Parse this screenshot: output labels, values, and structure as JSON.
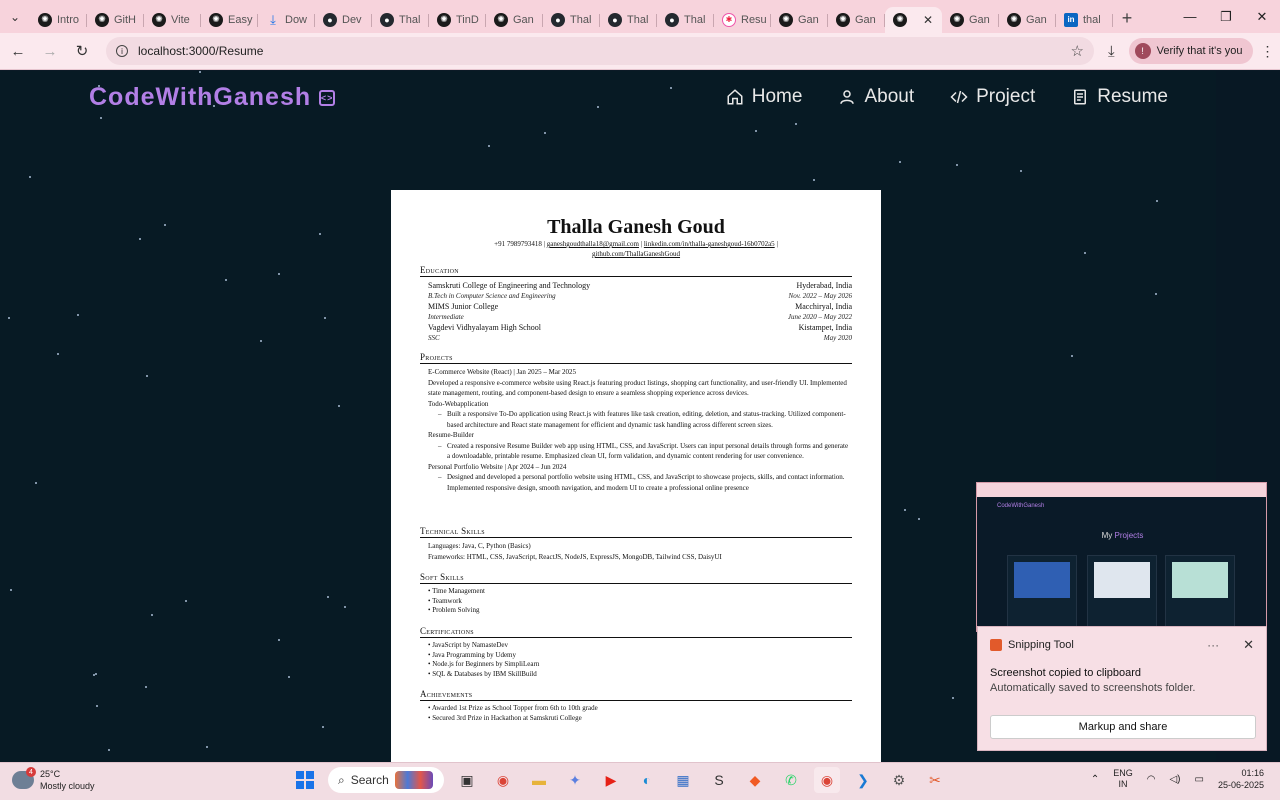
{
  "browser": {
    "tabs": [
      {
        "label": "Intro",
        "icon": "openai-icon"
      },
      {
        "label": "GitH",
        "icon": "openai-icon"
      },
      {
        "label": "Vite",
        "icon": "openai-icon"
      },
      {
        "label": "Easy",
        "icon": "openai-icon"
      },
      {
        "label": "Dow",
        "icon": "download-icon"
      },
      {
        "label": "Dev",
        "icon": "github-icon"
      },
      {
        "label": "Thal",
        "icon": "github-icon"
      },
      {
        "label": "TinD",
        "icon": "openai-icon"
      },
      {
        "label": "Gan",
        "icon": "openai-icon"
      },
      {
        "label": "Thal",
        "icon": "github-icon"
      },
      {
        "label": "Thal",
        "icon": "github-icon"
      },
      {
        "label": "Thal",
        "icon": "github-icon"
      },
      {
        "label": "Resu",
        "icon": "extension-icon"
      },
      {
        "label": "Gan",
        "icon": "openai-icon"
      },
      {
        "label": "Gan",
        "icon": "openai-icon"
      },
      {
        "label": "",
        "icon": "openai-icon",
        "active": true
      },
      {
        "label": "Gan",
        "icon": "openai-icon"
      },
      {
        "label": "Gan",
        "icon": "openai-icon"
      },
      {
        "label": "thal",
        "icon": "linkedin-icon"
      }
    ],
    "url": "localhost:3000/Resume",
    "verify_label": "Verify that it's you"
  },
  "site": {
    "brand": "CodeWithGanesh",
    "nav": [
      {
        "label": "Home",
        "icon": "home-icon"
      },
      {
        "label": "About",
        "icon": "user-icon"
      },
      {
        "label": "Project",
        "icon": "code-icon"
      },
      {
        "label": "Resume",
        "icon": "document-icon"
      }
    ],
    "brand_color": "#b27fe6"
  },
  "resume": {
    "name": "Thalla Ganesh Goud",
    "contact_line1": "+91 7989793418 | ",
    "email": "ganeshgoudthalla18@gmail.com",
    "sep": " | ",
    "linkedin": "linkedin.com/in/thalla-ganeshgoud-16b0702a5",
    "contact_tail": " |",
    "github": "github.com/ThallaGaneshGoud",
    "education_title": "Education",
    "education": [
      {
        "school": "Samskruti College of Engineering and Technology",
        "place": "Hyderabad, India",
        "degree": "B.Tech in Computer Science and Engineering",
        "dates": "Nov. 2022 – May 2026"
      },
      {
        "school": "MIMS Junior College",
        "place": "Macchiryal, India",
        "degree": "Intermediate",
        "dates": "June 2020 – May 2022"
      },
      {
        "school": "Vagdevi Vidhyalayam High School",
        "place": "Kistampet, India",
        "degree": "SSC",
        "dates": "May 2020"
      }
    ],
    "projects_title": "Projects",
    "projects": {
      "p1_title": "E-Commerce Website (React) | Jan 2025 – Mar 2025",
      "p1_desc": "Developed a responsive e-commerce website using React.js featuring product listings, shopping cart functionality, and user-friendly UI. Implemented state management, routing, and component-based design to ensure a seamless shopping experience across devices.",
      "p2_title": "Todo-Webapplication",
      "p2_desc": "Built a responsive To-Do application using React.js with features like task creation, editing, deletion, and status-tracking. Utilized component-based architecture and React state management for efficient and dynamic task handling across different screen sizes.",
      "p3_title": "Resume-Builder",
      "p3_desc": "Created a responsive Resume Builder web app using HTML, CSS, and JavaScript. Users can input personal details through forms and generate a downloadable, printable resume. Emphasized clean UI, form validation, and dynamic content rendering for user convenience.",
      "p4_title": "Personal Portfolio Website | Apr 2024 – Jun 2024",
      "p4_desc": "Designed and developed a personal portfolio website using HTML, CSS, and JavaScript to showcase projects, skills, and contact information. Implemented responsive design, smooth navigation, and modern UI to create a professional online presence"
    },
    "tech_title": "Technical Skills",
    "languages": "Languages: Java, C, Python (Basics)",
    "frameworks": "Frameworks: HTML, CSS, JavaScript, ReactJS, NodeJS, ExpressJS, MongoDB, Tailwind CSS, DaisyUI",
    "soft_title": "Soft Skills",
    "soft": [
      "Time Management",
      "Teamwork",
      "Problem Solving"
    ],
    "cert_title": "Certifications",
    "certs": [
      "JavaScript by NamasteDev",
      "Java Programming by Udemy",
      "Node.js for Beginners by SimpliLearn",
      "SQL & Databases by IBM SkillBuild"
    ],
    "ach_title": "Achievements",
    "achievements": [
      "Awarded 1st Prize as School Topper from 6th to 10th grade",
      "Secured 3rd Prize in Hackathon at Samskruti College"
    ]
  },
  "preview": {
    "brand": "CodeWithGanesh",
    "title_a": "My ",
    "title_b": "Projects"
  },
  "toast": {
    "app": "Snipping Tool",
    "line1": "Screenshot copied to clipboard",
    "line2": "Automatically saved to screenshots folder.",
    "button": "Markup and share"
  },
  "taskbar": {
    "temp": "25°C",
    "condition": "Mostly cloudy",
    "weather_badge": "4",
    "search": "Search",
    "lang1": "ENG",
    "lang2": "IN",
    "time": "01:16",
    "date": "25-06-2025"
  }
}
